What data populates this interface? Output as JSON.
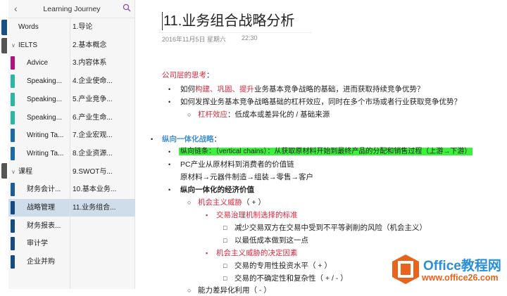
{
  "header": {
    "title": "Learning Journey",
    "back_icon": "chevron-left",
    "search_icon": "search"
  },
  "sections": [
    {
      "label": "Words",
      "type": "top",
      "color": "#1b5c93"
    },
    {
      "label": "IELTS",
      "type": "group"
    },
    {
      "label": "Advice",
      "color": "#b3127c"
    },
    {
      "label": "Speaking...",
      "color": "#2bb5a3"
    },
    {
      "label": "Speaking...",
      "color": "#2bb5a3"
    },
    {
      "label": "Speaking...",
      "color": "#2bb5a3"
    },
    {
      "label": "Writing Ta...",
      "color": "#1c6aa6"
    },
    {
      "label": "Writing Ta...",
      "color": "#1c6aa6"
    },
    {
      "label": "课程",
      "type": "group"
    },
    {
      "label": "财务会计...",
      "color": "#1c5d97"
    },
    {
      "label": "战略管理",
      "color": "#164a82",
      "selected": true
    },
    {
      "label": "财务报表...",
      "color": "#164a82"
    },
    {
      "label": "审计学",
      "color": "#164a82"
    },
    {
      "label": "企业并购",
      "color": "#164a82"
    }
  ],
  "pages": [
    "1.导论",
    "2.基本概念",
    "3.内容体系",
    "4.企业使命...",
    "5.产业竞争...",
    "6.产业生命...",
    "7.企业宏观...",
    "8.企业资源...",
    "9.SWOT与...",
    "10.基本业务...",
    "11.业务组合..."
  ],
  "selected_page_index": 10,
  "note": {
    "title": "11.业务组合战略分析",
    "date": "2016年11月5日 星期六",
    "time": "22:30",
    "lines": {
      "l1": "公司层的思考",
      "l1b": "：",
      "l2a": "如何",
      "l2b": "构建、巩固、提升",
      "l2c": "业务基本竞争战略的基础，进而获取持续竞争优势？",
      "l3": "如何发挥业务基本竞争战略基础的杠杆效应，同时在多个市场或者行业获取竞争优势？",
      "l4a": "杠杆效应",
      "l4b": "：低成本或差异化的 / 基础来源",
      "l5a": "纵向一体化战略",
      "l5b": "：",
      "l6": "纵向链条：（vertical chains）：从获取原材料开始到最终产品的分配和销售过程（上游→下游）",
      "l7": "PC产业从原材料到消费者的价值链",
      "l8": "原材料→元器件制造→组装→零售→客户",
      "l9": "纵向一体化的经济价值",
      "l10a": "机会主义威胁",
      "l10b": "（ + ）",
      "l11": "交易治理机制选择的标准",
      "l12": "减少交易双方在交易中受到不平等剥削的风险（机会主义）",
      "l13": "以最低成本做到这一点",
      "l14": "机会主义威胁的决定因素",
      "l15": "交易的专用性投资水平（ + ）",
      "l16": "交易的不确定性和复杂性（ + / - ）",
      "l17": "能力差异化利用（ - ）"
    }
  },
  "watermark": {
    "name": "Office教程网",
    "url": "www.office26.com"
  },
  "colors": {
    "accent_red": "#d8283c",
    "accent_blue": "#3f8fcf",
    "highlight": "#3cf03c",
    "selection": "#cfdcea"
  }
}
